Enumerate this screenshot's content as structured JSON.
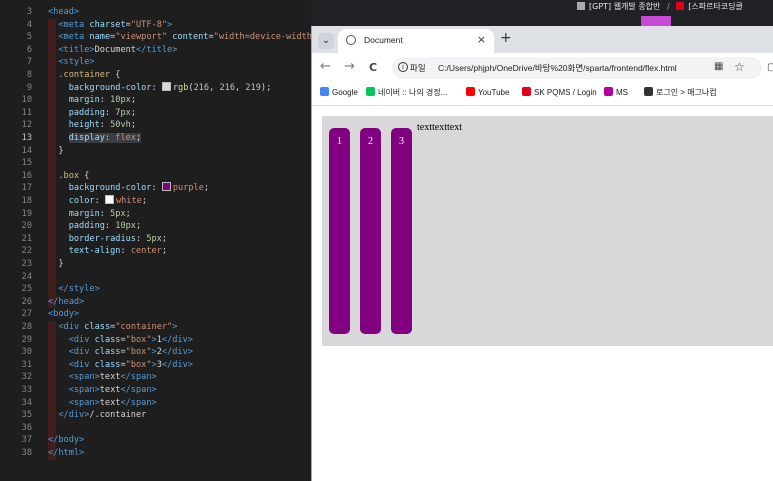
{
  "editor": {
    "lines": [
      {
        "n": "3",
        "html": "<span class='t-tag'>&lt;head&gt;</span>"
      },
      {
        "n": "4",
        "html": "  <span class='t-tag'>&lt;meta</span> <span class='t-attr'>charset</span>=<span class='t-str'>\"UTF-8\"</span><span class='t-tag'>&gt;</span>"
      },
      {
        "n": "5",
        "html": "  <span class='t-tag'>&lt;meta</span> <span class='t-attr'>name</span>=<span class='t-str'>\"viewport\"</span> <span class='t-attr'>content</span>=<span class='t-str'>\"width=device-width</span>"
      },
      {
        "n": "6",
        "html": "  <span class='t-tag'>&lt;title&gt;</span><span class='t-txt'>Document</span><span class='t-tag'>&lt;/title&gt;</span>"
      },
      {
        "n": "7",
        "html": "  <span class='t-tag'>&lt;style&gt;</span>"
      },
      {
        "n": "8",
        "html": "  <span class='t-sel'>.container</span> <span class='t-txt'>{</span>"
      },
      {
        "n": "9",
        "html": "    <span class='t-prop'>background-color</span>: <span class='swatch' style='background:rgb(216,216,219)'></span><span class='t-fn'>rgb</span>(<span class='t-num'>216</span>, <span class='t-num'>216</span>, <span class='t-num'>219</span>);"
      },
      {
        "n": "10",
        "html": "    <span class='t-prop'>margin</span>: <span class='t-num'>10px</span>;"
      },
      {
        "n": "11",
        "html": "    <span class='t-prop'>padding</span>: <span class='t-num'>7px</span>;"
      },
      {
        "n": "12",
        "html": "    <span class='t-prop'>height</span>: <span class='t-num'>50vh</span>;"
      },
      {
        "n": "13",
        "html": "    <span class='sel'><span class='t-prop'>display</span>: <span class='t-val'>flex</span>;</span>",
        "active": true
      },
      {
        "n": "14",
        "html": "  <span class='t-txt'>}</span>"
      },
      {
        "n": "15",
        "html": ""
      },
      {
        "n": "16",
        "html": "  <span class='t-sel'>.box</span> <span class='t-txt'>{</span>"
      },
      {
        "n": "17",
        "html": "    <span class='t-prop'>background-color</span>: <span class='swatch' style='background:purple'></span><span class='t-val'>purple</span>;"
      },
      {
        "n": "18",
        "html": "    <span class='t-prop'>color</span>: <span class='swatch' style='background:#fff'></span><span class='t-val'>white</span>;"
      },
      {
        "n": "19",
        "html": "    <span class='t-prop'>margin</span>: <span class='t-num'>5px</span>;"
      },
      {
        "n": "20",
        "html": "    <span class='t-prop'>padding</span>: <span class='t-num'>10px</span>;"
      },
      {
        "n": "21",
        "html": "    <span class='t-prop'>border-radius</span>: <span class='t-num'>5px</span>;"
      },
      {
        "n": "22",
        "html": "    <span class='t-prop'>text-align</span>: <span class='t-val'>center</span>;"
      },
      {
        "n": "23",
        "html": "  <span class='t-txt'>}</span>"
      },
      {
        "n": "24",
        "html": ""
      },
      {
        "n": "25",
        "html": "  <span class='t-tag'>&lt;/style&gt;</span>"
      },
      {
        "n": "26",
        "html": "<span class='t-tag'>&lt;/head&gt;</span>"
      },
      {
        "n": "27",
        "html": "<span class='t-tag'>&lt;body&gt;</span>"
      },
      {
        "n": "28",
        "html": "  <span class='t-tag'>&lt;div</span> <span class='t-attr'>class</span>=<span class='t-str'>\"container\"</span><span class='t-tag'>&gt;</span>"
      },
      {
        "n": "29",
        "html": "    <span class='t-tag'>&lt;div</span> <span class='t-attr'>class</span>=<span class='t-str'>\"box\"</span><span class='t-tag'>&gt;</span><span class='t-txt'>1</span><span class='t-tag'>&lt;/div&gt;</span>"
      },
      {
        "n": "30",
        "html": "    <span class='t-tag'>&lt;div</span> <span class='t-attr'>class</span>=<span class='t-str'>\"box\"</span><span class='t-tag'>&gt;</span><span class='t-txt'>2</span><span class='t-tag'>&lt;/div&gt;</span>"
      },
      {
        "n": "31",
        "html": "    <span class='t-tag'>&lt;div</span> <span class='t-attr'>class</span>=<span class='t-str'>\"box\"</span><span class='t-tag'>&gt;</span><span class='t-txt'>3</span><span class='t-tag'>&lt;/div&gt;</span>"
      },
      {
        "n": "32",
        "html": "    <span class='t-tag'>&lt;span&gt;</span><span class='t-txt'>text</span><span class='t-tag'>&lt;/span&gt;</span>"
      },
      {
        "n": "33",
        "html": "    <span class='t-tag'>&lt;span&gt;</span><span class='t-txt'>text</span><span class='t-tag'>&lt;/span&gt;</span>"
      },
      {
        "n": "34",
        "html": "    <span class='t-tag'>&lt;span&gt;</span><span class='t-txt'>text</span><span class='t-tag'>&lt;/span&gt;</span>"
      },
      {
        "n": "35",
        "html": "  <span class='t-tag'>&lt;/div&gt;</span><span class='t-com'>/.container</span>"
      },
      {
        "n": "36",
        "html": ""
      },
      {
        "n": "37",
        "html": "<span class='t-tag'>&lt;/body&gt;</span>"
      },
      {
        "n": "38",
        "html": "<span class='t-tag'>&lt;/html&gt;</span>"
      }
    ]
  },
  "background_window": {
    "tab1": "[GPT] 웹개발 종합반",
    "separator": "/",
    "tab2": "[스파르타코딩클"
  },
  "browser": {
    "tab_dropdown_icon": "chevron-down-icon",
    "tab_title": "Document",
    "tab_close": "×",
    "new_tab": "+",
    "back": "←",
    "forward": "→",
    "reload": "C",
    "scheme_label": "파일",
    "url": "C:/Users/phjph/OneDrive/바탕%20화면/sparta/frontend/flex.html",
    "star": "☆",
    "bookmarks": [
      {
        "label": "Google",
        "color": "#4285f4"
      },
      {
        "label": "네이버 :: 나의 경정...",
        "color": "#03c75a"
      },
      {
        "label": "YouTube",
        "color": "#ff0000"
      },
      {
        "label": "SK PQMS / Login",
        "color": "#e2001a"
      },
      {
        "label": "MS",
        "color": "#b4009e"
      },
      {
        "label": "로그인 > 매그나컴",
        "color": "#333333"
      }
    ]
  },
  "page": {
    "boxes": [
      "1",
      "2",
      "3"
    ],
    "text": "texttexttext"
  }
}
